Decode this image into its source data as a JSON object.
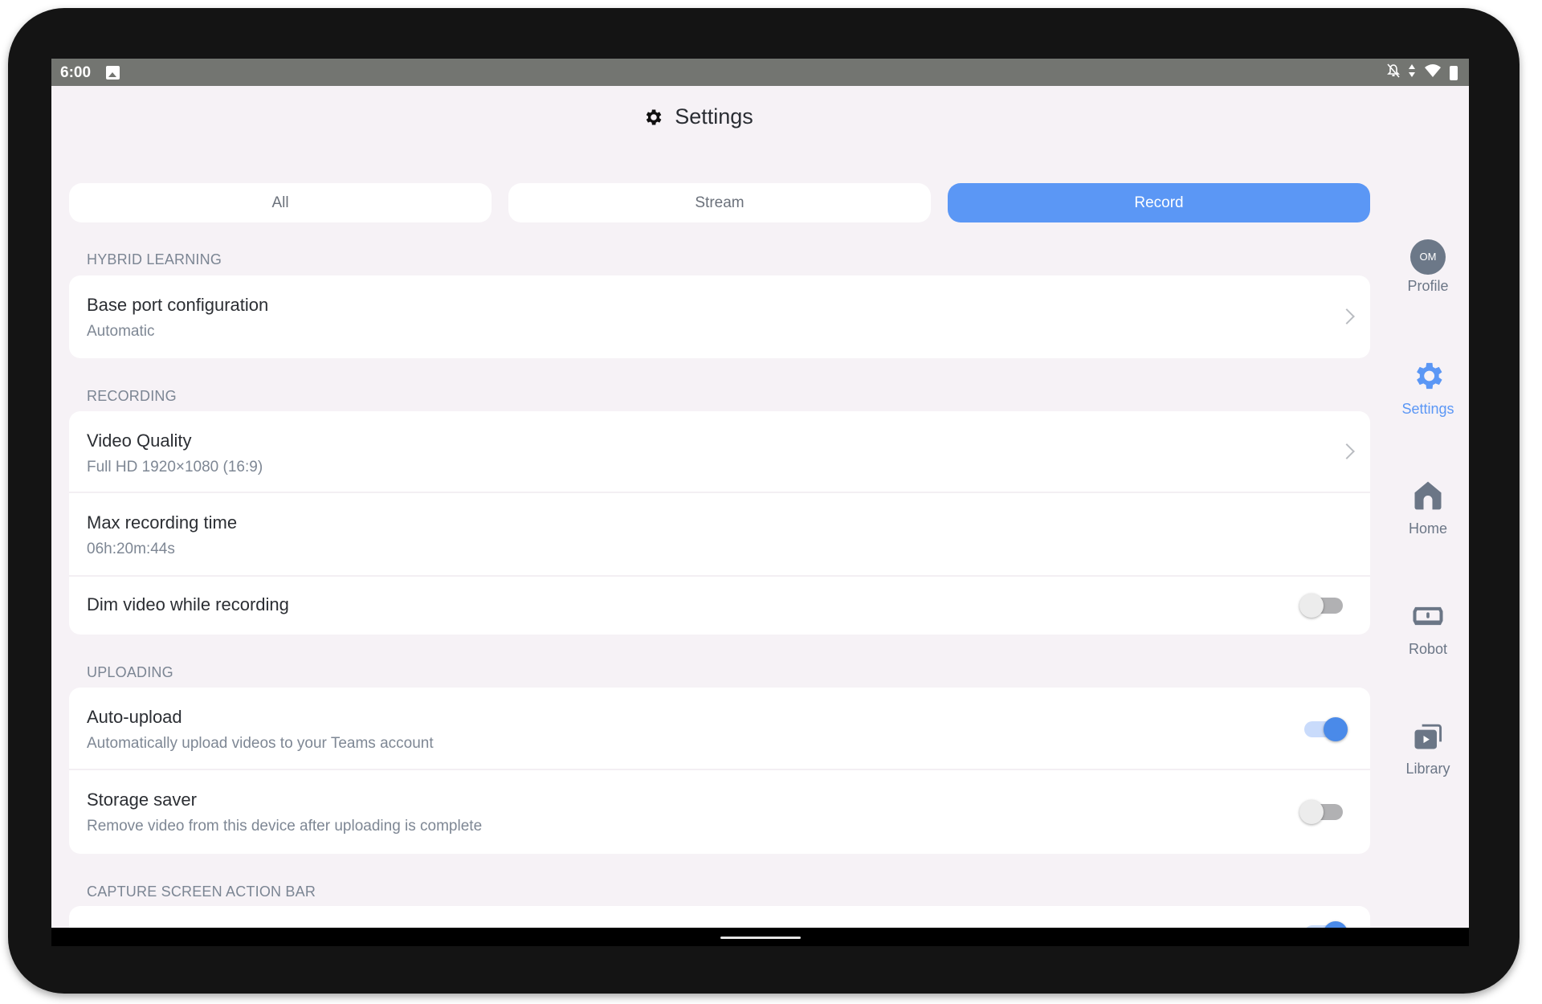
{
  "status_bar": {
    "time": "6:00",
    "left_icons": [
      "image-icon"
    ],
    "right_icons": [
      "notifications-off-icon",
      "data-arrows-icon",
      "wifi-icon",
      "battery-icon"
    ]
  },
  "header": {
    "title": "Settings",
    "icon": "gear-icon"
  },
  "tabs": [
    {
      "label": "All",
      "active": false
    },
    {
      "label": "Stream",
      "active": false
    },
    {
      "label": "Record",
      "active": true
    }
  ],
  "sections": [
    {
      "label": "HYBRID LEARNING",
      "rows": [
        {
          "title": "Base port configuration",
          "subtitle": "Automatic",
          "control": "chevron"
        }
      ]
    },
    {
      "label": "RECORDING",
      "rows": [
        {
          "title": "Video Quality",
          "subtitle": "Full HD 1920×1080 (16:9)",
          "control": "chevron"
        },
        {
          "title": "Max recording time",
          "subtitle": "06h:20m:44s",
          "control": "none"
        },
        {
          "title": "Dim video while recording",
          "control": "toggle",
          "value": false
        }
      ]
    },
    {
      "label": "UPLOADING",
      "rows": [
        {
          "title": "Auto-upload",
          "subtitle": "Automatically upload videos to your Teams account",
          "control": "toggle",
          "value": true
        },
        {
          "title": "Storage saver",
          "subtitle": "Remove video from this device after uploading is complete",
          "control": "toggle",
          "value": false
        }
      ]
    },
    {
      "label": "CAPTURE SCREEN ACTION BAR",
      "rows": [
        {
          "control": "toggle",
          "value": true
        }
      ]
    }
  ],
  "side_nav": [
    {
      "label": "Profile",
      "icon": "avatar",
      "avatar_initials": "OM",
      "active": false
    },
    {
      "label": "Settings",
      "icon": "gear-icon",
      "active": true
    },
    {
      "label": "Home",
      "icon": "home-icon",
      "active": false
    },
    {
      "label": "Robot",
      "icon": "robot-icon",
      "active": false
    },
    {
      "label": "Library",
      "icon": "library-icon",
      "active": false
    }
  ],
  "colors": {
    "accent": "#5b97f5",
    "toggle_on": "#4a8ae9",
    "background": "#f6f2f6",
    "status_bar": "#737571",
    "nav_icon": "#6b7686"
  }
}
